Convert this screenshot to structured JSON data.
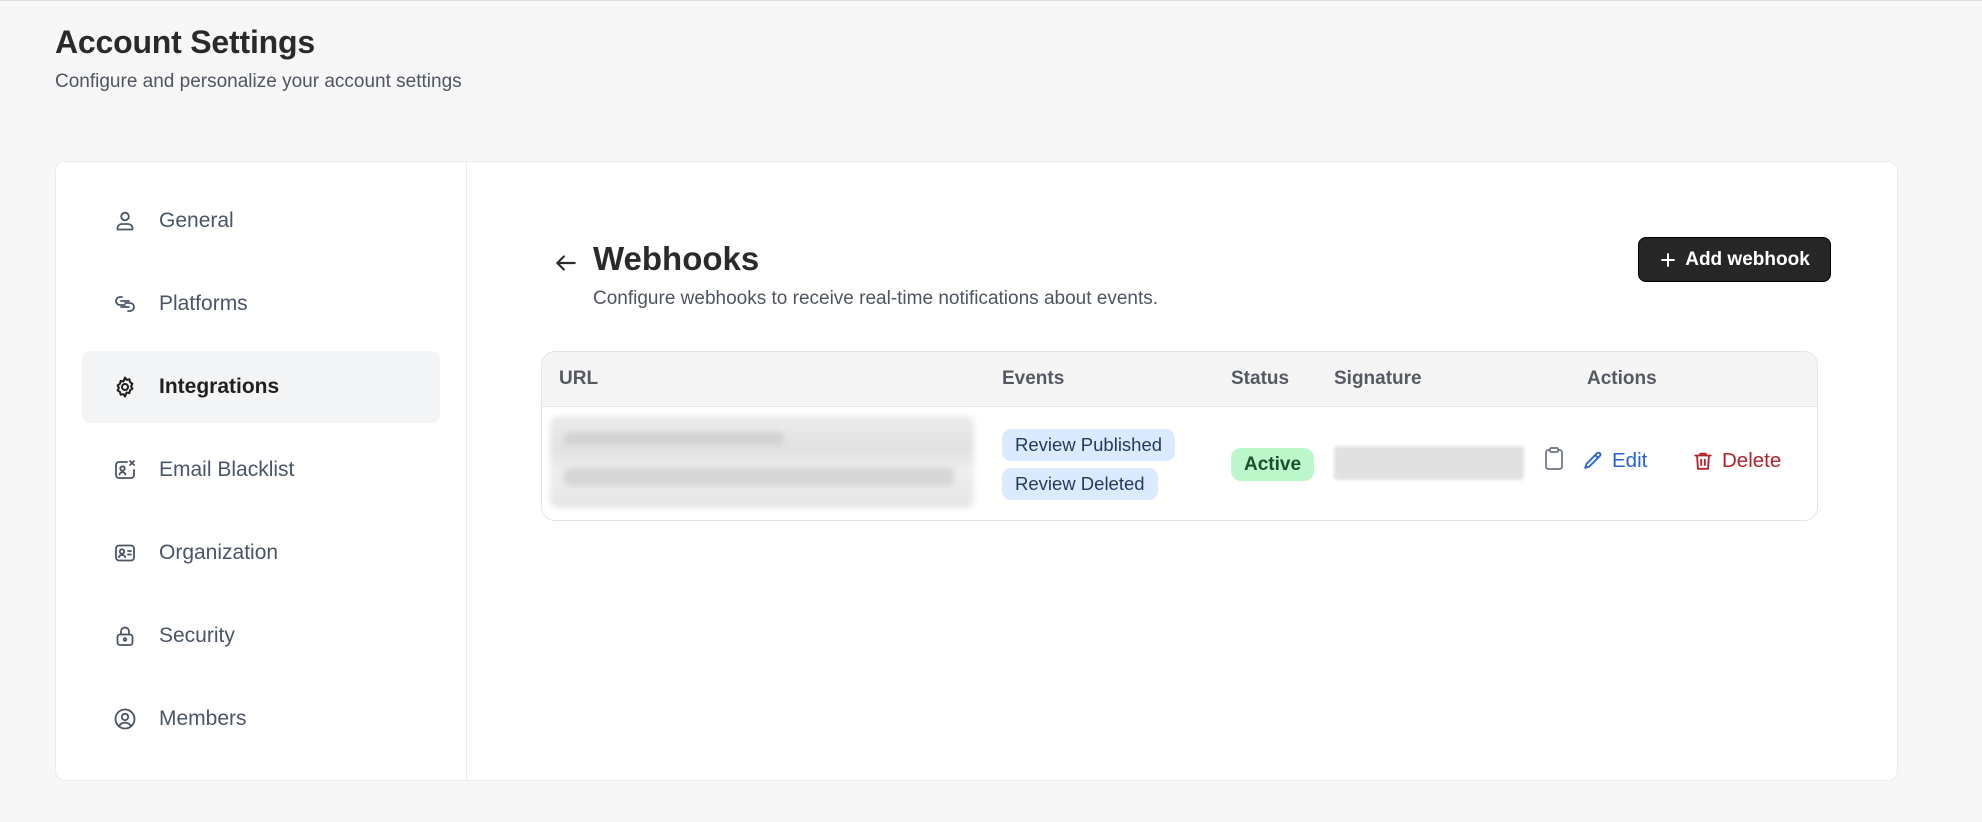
{
  "page": {
    "title": "Account Settings",
    "subtitle": "Configure and personalize your account settings"
  },
  "sidebar": {
    "items": [
      {
        "label": "General",
        "icon": "user-icon",
        "active": false
      },
      {
        "label": "Platforms",
        "icon": "link-icon",
        "active": false
      },
      {
        "label": "Integrations",
        "icon": "gear-icon",
        "active": true
      },
      {
        "label": "Email Blacklist",
        "icon": "email-block-icon",
        "active": false
      },
      {
        "label": "Organization",
        "icon": "id-card-icon",
        "active": false
      },
      {
        "label": "Security",
        "icon": "lock-icon",
        "active": false
      },
      {
        "label": "Members",
        "icon": "user-circle-icon",
        "active": false
      }
    ]
  },
  "webhooks": {
    "title": "Webhooks",
    "description": "Configure webhooks to receive real-time notifications about events.",
    "add_button_label": "Add webhook",
    "table": {
      "headers": {
        "url": "URL",
        "events": "Events",
        "status": "Status",
        "signature": "Signature",
        "actions": "Actions"
      },
      "rows": [
        {
          "events": [
            "Review Published",
            "Review Deleted"
          ],
          "status": "Active",
          "edit_label": "Edit",
          "delete_label": "Delete"
        }
      ]
    }
  },
  "colors": {
    "accent_dark": "#262626",
    "tag_bg": "#dbeafe",
    "status_active_bg": "#bbf7c8",
    "edit": "#2463d6",
    "delete": "#b3232b"
  }
}
